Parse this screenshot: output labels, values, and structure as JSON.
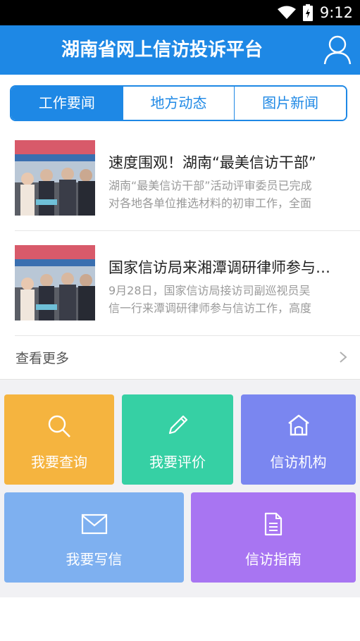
{
  "status_bar": {
    "time": "9:12"
  },
  "header": {
    "title": "湖南省网上信访投诉平台"
  },
  "tabs": [
    {
      "label": "工作要闻",
      "active": true
    },
    {
      "label": "地方动态",
      "active": false
    },
    {
      "label": "图片新闻",
      "active": false
    }
  ],
  "news": [
    {
      "title": "速度围观！湖南“最美信访干部”",
      "summary_line1": "湖南“最美信访干部”活动评审委员已完成",
      "summary_line2": "对各地各单位推选材料的初审工作，全面"
    },
    {
      "title": "国家信访局来湘潭调研律师参与信访工作",
      "summary_line1": "9月28日，国家信访局接访司副巡视员吴",
      "summary_line2": "信一行来潭调研律师参与信访工作，高度"
    }
  ],
  "more": {
    "label": "查看更多"
  },
  "tiles": [
    {
      "label": "我要查询",
      "icon": "search-icon",
      "color": "#f5b43f"
    },
    {
      "label": "我要评价",
      "icon": "pencil-icon",
      "color": "#36d0a4"
    },
    {
      "label": "信访机构",
      "icon": "house-icon",
      "color": "#7a86f0"
    },
    {
      "label": "我要写信",
      "icon": "mail-icon",
      "color": "#7eb0f0"
    },
    {
      "label": "信访指南",
      "icon": "document-icon",
      "color": "#a875f2"
    }
  ],
  "colors": {
    "primary": "#1e88e5"
  }
}
